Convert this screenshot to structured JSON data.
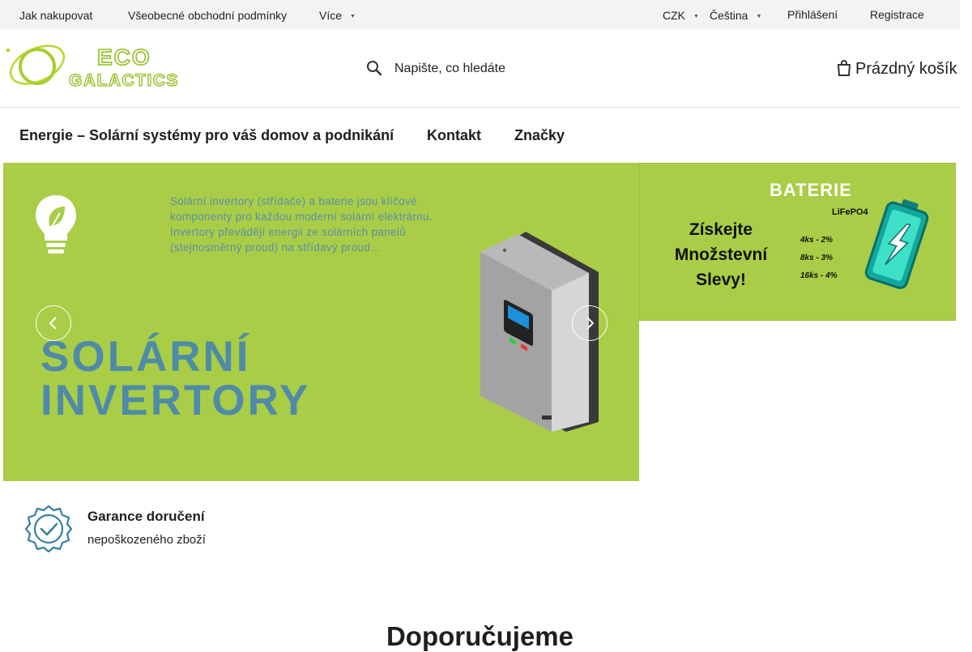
{
  "topbar": {
    "links": [
      "Jak nakupovat",
      "Všeobecné obchodní podmínky"
    ],
    "more": "Více",
    "currency": "CZK",
    "language": "Čeština",
    "login": "Přihlášení",
    "register": "Registrace"
  },
  "logo": {
    "line1": "ECO",
    "line2": "GALACTICS"
  },
  "search": {
    "placeholder": "Napište, co hledáte",
    "icon": "search-icon"
  },
  "cart": {
    "label": "Prázdný košík",
    "icon": "cart-icon"
  },
  "main_nav": [
    "Energie – Solární systémy pro váš domov a podnikání",
    "Kontakt",
    "Značky"
  ],
  "hero": {
    "blurb": "Solární invertory (střídače) a baterie jsou klíčové komponenty pro každou moderní solární elektrárnu. Invertory převádějí energii ze solárních panelů (stejnosměrný proud) na střídavý proud...",
    "headline_line1": "SOLÁRNÍ",
    "headline_line2": "INVERTORY",
    "background": "#a9cd46",
    "prev_icon": "chevron-left-icon",
    "next_icon": "chevron-right-icon"
  },
  "promo": {
    "heading": "BATERIE",
    "subheading": "LiFePO4",
    "main_line1": "Získejte",
    "main_line2": "Množstevní",
    "main_line3": "Slevy!",
    "tiers": [
      "4ks - 2%",
      "8ks - 3%",
      "16ks - 4%"
    ]
  },
  "guarantee": {
    "title": "Garance doručení",
    "subtitle": "nepoškozeného zboží",
    "icon": "badge-check-icon"
  },
  "section": {
    "title": "Doporučujeme"
  },
  "colors": {
    "brand_green": "#a9cd46",
    "brand_blue": "#4f8ba8",
    "topbar_bg": "#f3f3f3"
  }
}
